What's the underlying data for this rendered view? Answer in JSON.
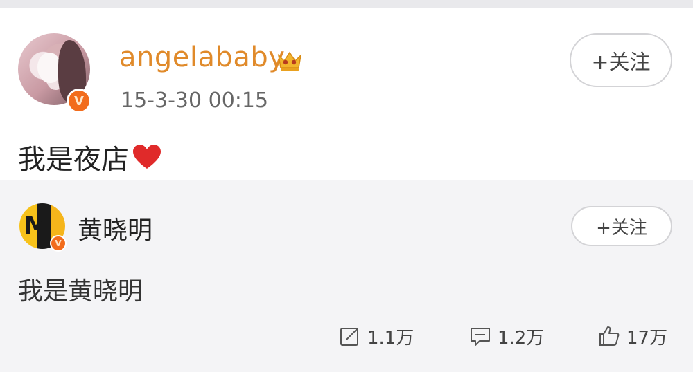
{
  "post": {
    "username": "angelababy",
    "timestamp": "15-3-30 00:15",
    "text": "我是夜店",
    "follow_label": "+关注",
    "badge": "V",
    "icons": [
      "avatar",
      "crown-icon",
      "heart-icon",
      "verified-badge"
    ]
  },
  "repost": {
    "username": "黄晓明",
    "text": "我是黄晓明",
    "follow_label": "+关注",
    "badge": "V"
  },
  "actions": {
    "repost_count": "1.1万",
    "comment_count": "1.2万",
    "like_count": "17万",
    "icons": [
      "repost-icon",
      "comment-icon",
      "like-icon"
    ]
  },
  "colors": {
    "username": "#e08a2a",
    "badge": "#f26c1c",
    "heart": "#e02a2a"
  }
}
